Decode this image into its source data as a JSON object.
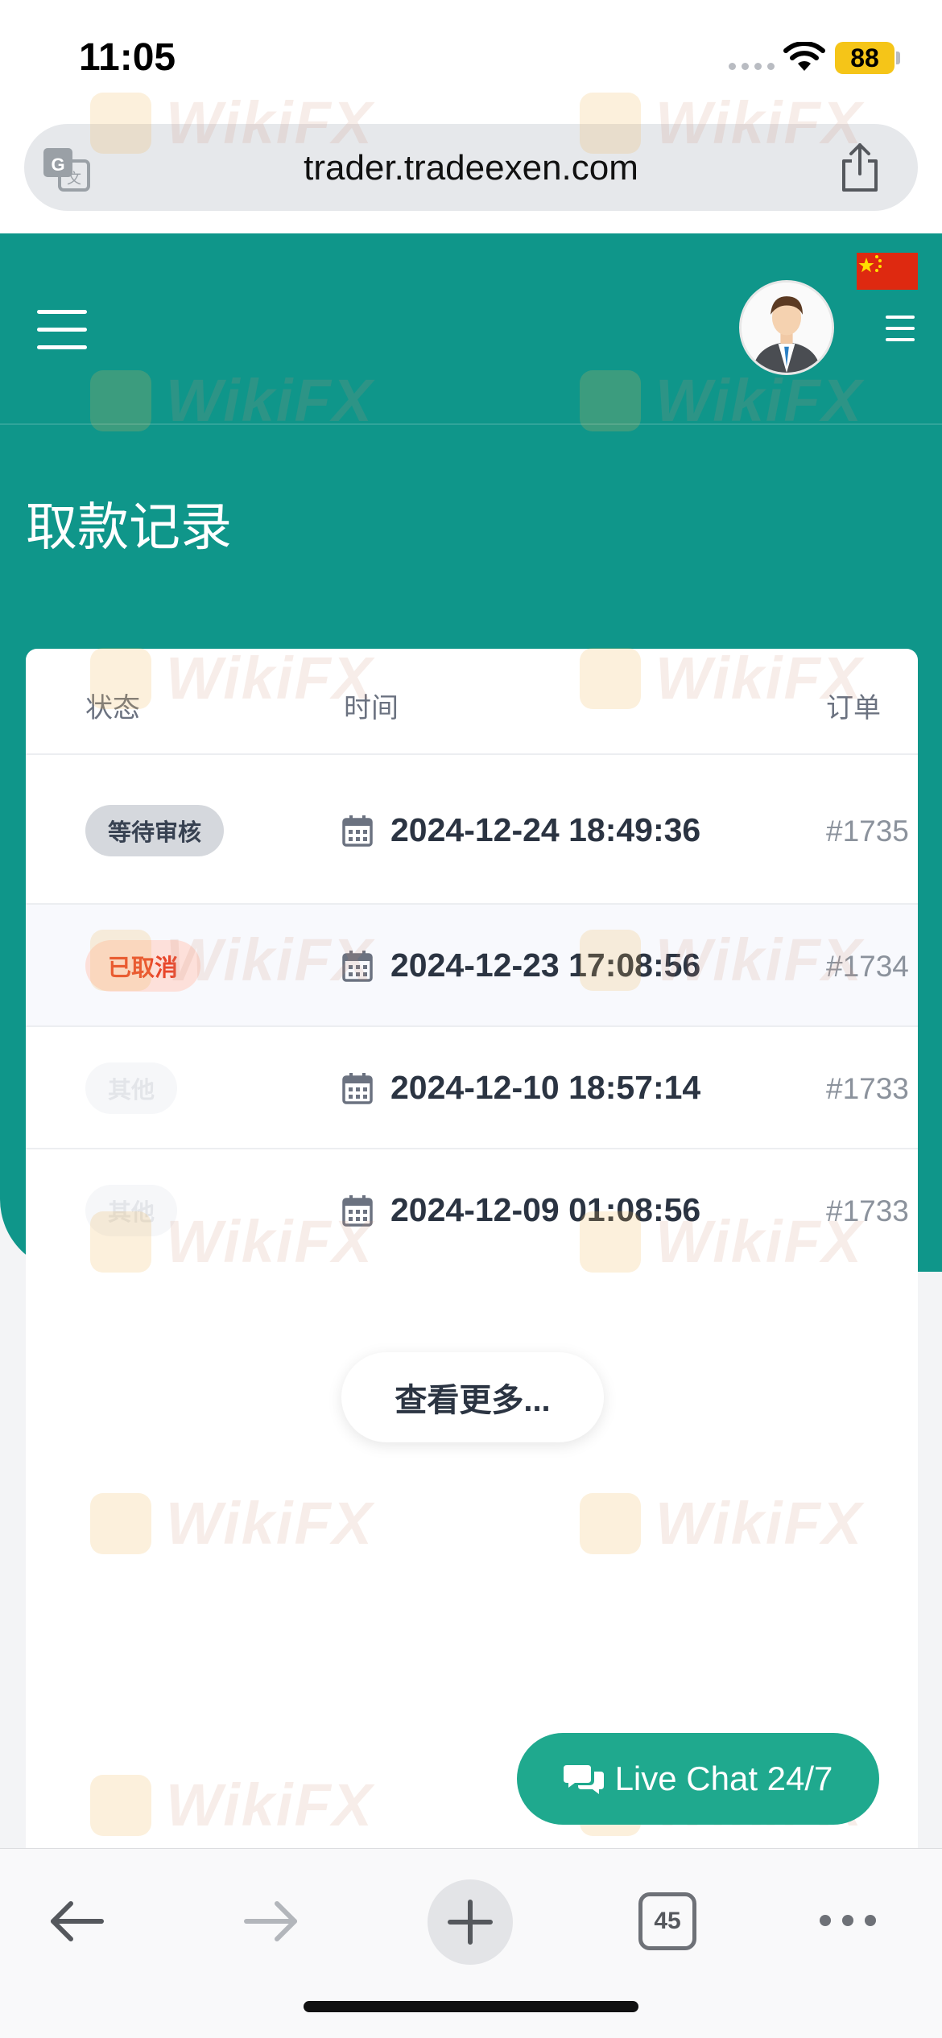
{
  "status_bar": {
    "time": "11:05",
    "battery": "88"
  },
  "browser": {
    "url": "trader.tradeexen.com",
    "tab_count": "45"
  },
  "header": {
    "page_title": "取款记录"
  },
  "table": {
    "columns": {
      "status": "状态",
      "time": "时间",
      "order": "订单"
    },
    "rows": [
      {
        "status": "等待审核",
        "datetime": "2024-12-24 18:49:36",
        "order": "#1735"
      },
      {
        "status": "已取消",
        "datetime": "2024-12-23 17:08:56",
        "order": "#1734"
      },
      {
        "status": "其他",
        "datetime": "2024-12-10 18:57:14",
        "order": "#1733"
      },
      {
        "status": "其他",
        "datetime": "2024-12-09 01:08:56",
        "order": "#1733"
      }
    ],
    "load_more": "查看更多..."
  },
  "live_chat": {
    "label": "Live Chat 24/7"
  },
  "watermark": "WikiFX",
  "colors": {
    "header": "#0f968a",
    "live_chat": "#1fa98e",
    "cancelled": "#e8462a"
  }
}
